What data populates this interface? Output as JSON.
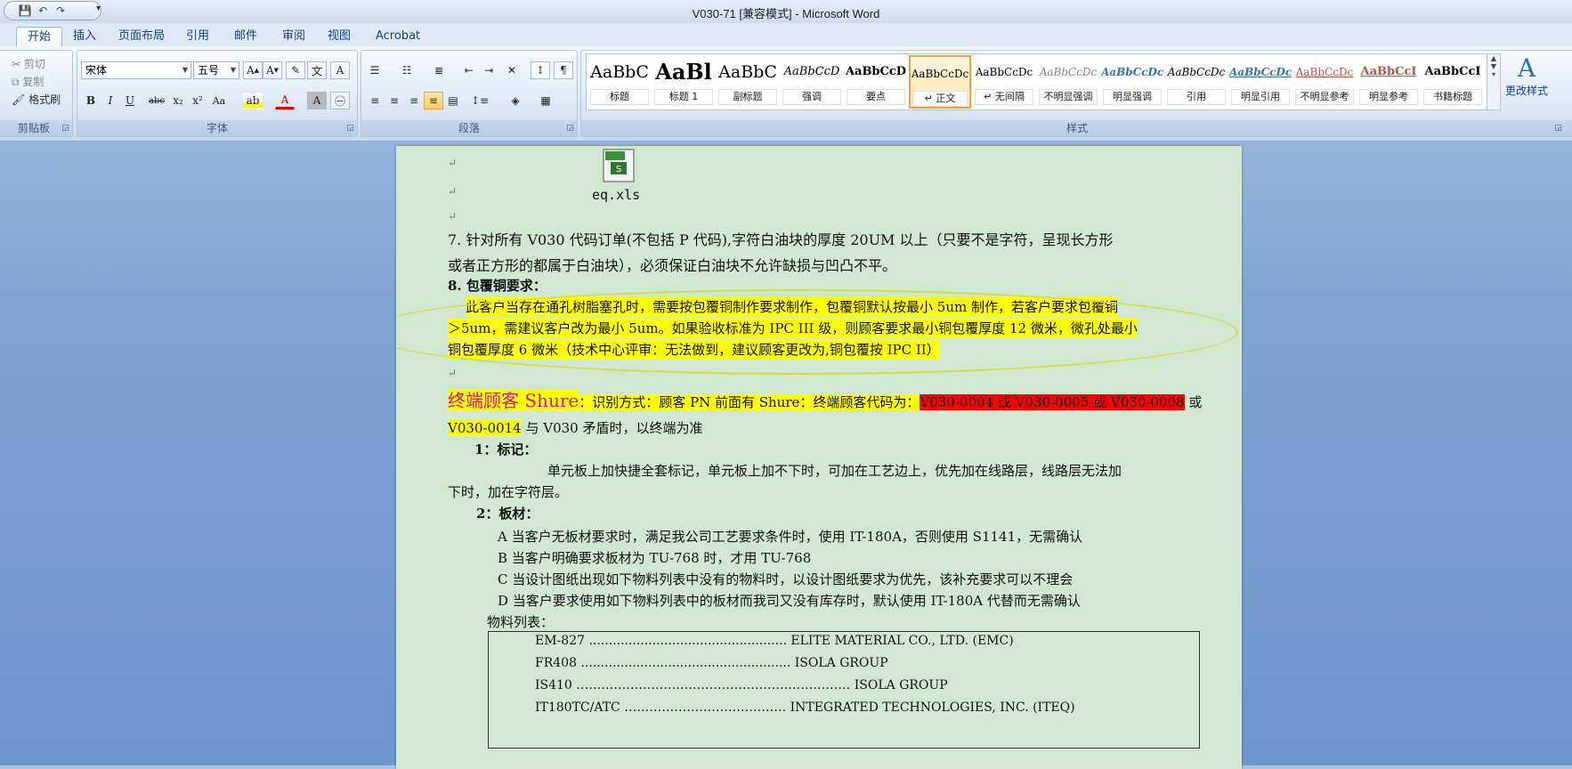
{
  "window": {
    "title": "V030-71 [兼容模式] - Microsoft Word"
  },
  "tabs": [
    {
      "label": "开始",
      "active": true
    },
    {
      "label": "插入"
    },
    {
      "label": "页面布局"
    },
    {
      "label": "引用"
    },
    {
      "label": "邮件"
    },
    {
      "label": "审阅"
    },
    {
      "label": "视图"
    },
    {
      "label": "Acrobat"
    }
  ],
  "clipboard": {
    "cut": "剪切",
    "copy": "复制",
    "format_painter": "格式刷",
    "group": "剪贴板"
  },
  "font": {
    "name": "宋体",
    "size": "五号",
    "group": "字体"
  },
  "paragraph": {
    "group": "段落"
  },
  "styles": {
    "group": "样式",
    "change_styles": "更改样式",
    "items": [
      {
        "preview": "AaBbC",
        "name": "标题"
      },
      {
        "preview": "AaBl",
        "name": "标题 1"
      },
      {
        "preview": "AaBbC",
        "name": "副标题"
      },
      {
        "preview": "AaBbCcD",
        "name": "强调"
      },
      {
        "preview": "AaBbCcD",
        "name": "要点"
      },
      {
        "preview": "AaBbCcDc",
        "name": "↵ 正文"
      },
      {
        "preview": "AaBbCcDc",
        "name": "↵ 无间隔"
      },
      {
        "preview": "AaBbCcDc",
        "name": "不明显强调"
      },
      {
        "preview": "AaBbCcDc",
        "name": "明显强调"
      },
      {
        "preview": "AaBbCcDc",
        "name": "引用"
      },
      {
        "preview": "AaBbCcDc",
        "name": "明显引用"
      },
      {
        "preview": "AaBbCcDc",
        "name": "不明显参考"
      },
      {
        "preview": "AaBbCcI",
        "name": "明显参考"
      },
      {
        "preview": "AaBbCcI",
        "name": "书籍标题"
      }
    ]
  },
  "document": {
    "embedded_file": "eq.xls",
    "item7_line1": "7. 针对所有 V030 代码订单(不包括 P 代码),字符白油块的厚度 20UM 以上（只要不是字符，呈现长方形",
    "item7_line2": "或者正方形的都属于白油块），必须保证白油块不允许缺损与凹凸不平。",
    "item8_title": "8. 包覆铜要求：",
    "item8_line1": "此客户当存在通孔树脂塞孔时，需要按包覆铜制作要求制作，包覆铜默认按最小 5um 制作，若客户要求包覆铜",
    "item8_line2": "＞5um，需建议客户改为最小 5um。如果验收标准为 IPC III 级，则顾客要求最小铜包覆厚度 12 微米，微孔处最小",
    "item8_line3": "铜包覆厚度 6 微米（技术中心评审：无法做到，建议顾客更改为,铜包覆按 IPC II）",
    "shure_title": "终端顾客 Shure",
    "shure_ident": "：识别方式：顾客 PN 前面有 Shure：终端顾客代码为：",
    "shure_codes": "V030-0004 或 V030-0005 或 V030-0008",
    "shure_or": " 或",
    "shure_code4": "V030-0014",
    "shure_conflict": " 与 V030 矛盾时，以终端为准",
    "mark_title": "1：标记：",
    "mark_line1": "单元板上加快捷全套标记，单元板上加不下时，可加在工艺边上，优先加在线路层，线路层无法加",
    "mark_line2": "下时，加在字符层。",
    "board_title": "2：板材：",
    "board_a": "A 当客户无板材要求时，满足我公司工艺要求条件时，使用 IT-180A，否则使用 S1141，无需确认",
    "board_b": "B 当客户明确要求板材为 TU-768 时，才用 TU-768",
    "board_c": "C 当设计图纸出现如下物料列表中没有的物料时，以设计图纸要求为优先，该补充要求可以不理会",
    "board_d": "D 当客户要求使用如下物料列表中的板材而我司又没有库存时，默认使用 IT-180A 代替而无需确认",
    "material_list": "物料列表：",
    "materials": [
      "EM-827 .................................................. ELITE MATERIAL CO., LTD. (EMC)",
      "FR408 ..................................................... ISOLA GROUP",
      "IS410 ………………………………………………………… ISOLA GROUP",
      "IT180TC/ATC ………………………………… INTEGRATED TECHNOLOGIES, INC. (ITEQ)"
    ]
  }
}
